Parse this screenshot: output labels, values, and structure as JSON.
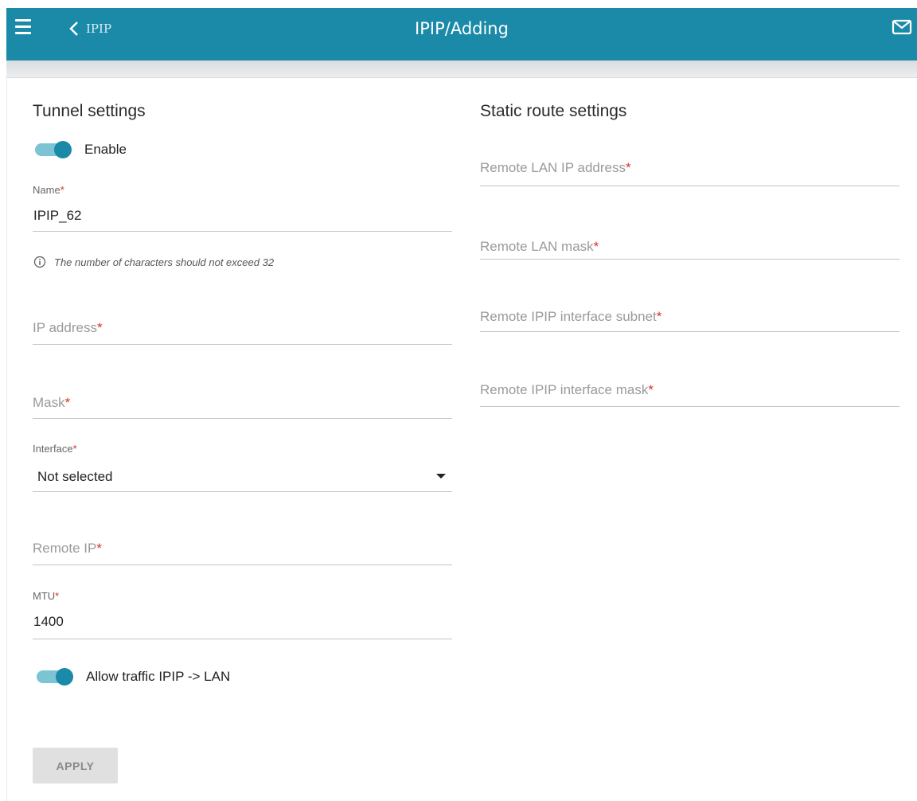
{
  "header": {
    "back_label": "IPIP",
    "title": "IPIP/Adding"
  },
  "tunnel": {
    "title": "Tunnel settings",
    "enable_label": "Enable",
    "name_label": "Name",
    "name_value": "IPIP_62",
    "name_hint": "The number of characters should not exceed 32",
    "ip_placeholder": "IP address",
    "mask_placeholder": "Mask",
    "interface_label": "Interface",
    "interface_value": "Not selected",
    "remote_ip_placeholder": "Remote IP",
    "mtu_label": "MTU",
    "mtu_value": "1400",
    "allow_traffic_label": "Allow traffic IPIP -> LAN"
  },
  "static_route": {
    "title": "Static route settings",
    "remote_lan_ip_placeholder": "Remote LAN IP address",
    "remote_lan_mask_placeholder": "Remote LAN mask",
    "remote_ipip_subnet_placeholder": "Remote IPIP interface subnet",
    "remote_ipip_mask_placeholder": "Remote IPIP interface mask"
  },
  "required_mark": "*",
  "apply_label": "APPLY",
  "colors": {
    "header": "#1a8aa8",
    "toggle_track": "#7cc3d4",
    "required": "#d93025"
  }
}
